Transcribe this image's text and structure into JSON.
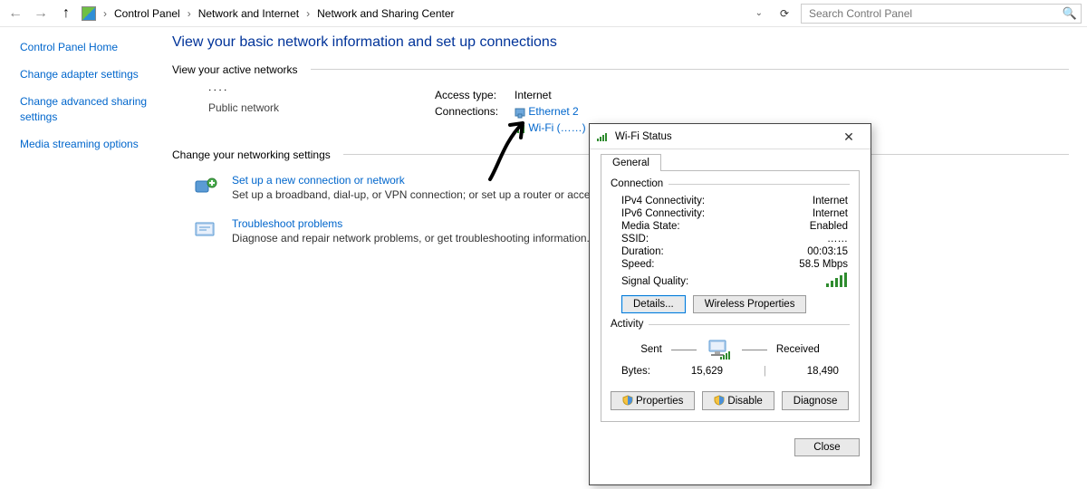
{
  "breadcrumb": {
    "items": [
      "Control Panel",
      "Network and Internet",
      "Network and Sharing Center"
    ]
  },
  "search": {
    "placeholder": "Search Control Panel"
  },
  "sidebar": {
    "items": [
      "Control Panel Home",
      "Change adapter settings",
      "Change advanced sharing settings",
      "Media streaming options"
    ]
  },
  "main": {
    "heading": "View your basic network information and set up connections",
    "active_hdr": "View your active networks",
    "network_name": "˙˙˙˙",
    "network_type": "Public network",
    "access_label": "Access type:",
    "access_value": "Internet",
    "conn_label": "Connections:",
    "conn1": "Ethernet 2",
    "conn2": "Wi-Fi (……)",
    "change_hdr": "Change your networking settings",
    "setup": {
      "title": "Set up a new connection or network",
      "desc": "Set up a broadband, dial-up, or VPN connection; or set up a router or access point."
    },
    "trouble": {
      "title": "Troubleshoot problems",
      "desc": "Diagnose and repair network problems, or get troubleshooting information."
    }
  },
  "dialog": {
    "title": "Wi-Fi Status",
    "tab": "General",
    "conn_legend": "Connection",
    "act_legend": "Activity",
    "rows": {
      "ipv4_k": "IPv4 Connectivity:",
      "ipv4_v": "Internet",
      "ipv6_k": "IPv6 Connectivity:",
      "ipv6_v": "Internet",
      "media_k": "Media State:",
      "media_v": "Enabled",
      "ssid_k": "SSID:",
      "ssid_v": "……",
      "dur_k": "Duration:",
      "dur_v": "00:03:15",
      "spd_k": "Speed:",
      "spd_v": "58.5 Mbps",
      "sig_k": "Signal Quality:"
    },
    "buttons": {
      "details": "Details...",
      "wprops": "Wireless Properties",
      "props": "Properties",
      "disable": "Disable",
      "diagnose": "Diagnose",
      "close": "Close"
    },
    "activity": {
      "sent": "Sent",
      "received": "Received",
      "bytes_label": "Bytes:",
      "bytes_sent": "15,629",
      "bytes_recv": "18,490"
    }
  }
}
